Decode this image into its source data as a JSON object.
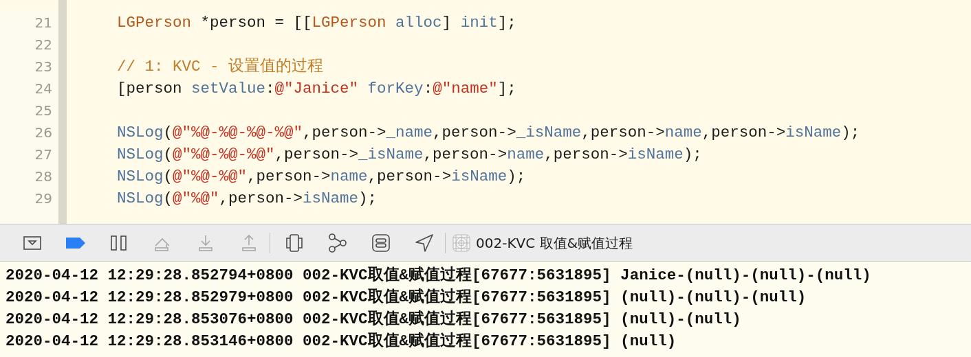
{
  "editor": {
    "lines": [
      {
        "number": "21",
        "tokens": [
          {
            "kind": "type",
            "text": "LGPerson"
          },
          {
            "kind": "plain",
            "text": " *person = [["
          },
          {
            "kind": "type",
            "text": "LGPerson"
          },
          {
            "kind": "method",
            "text": " alloc"
          },
          {
            "kind": "plain",
            "text": "] "
          },
          {
            "kind": "method",
            "text": "init"
          },
          {
            "kind": "plain",
            "text": "];"
          }
        ]
      },
      {
        "number": "22"
      },
      {
        "number": "23",
        "tokens": [
          {
            "kind": "comment",
            "text": "// 1: KVC - 设置值的过程"
          }
        ]
      },
      {
        "number": "24",
        "tokens": [
          {
            "kind": "plain",
            "text": "[person "
          },
          {
            "kind": "method",
            "text": "setValue"
          },
          {
            "kind": "plain",
            "text": ":"
          },
          {
            "kind": "string",
            "text": "@\"Janice\""
          },
          {
            "kind": "method",
            "text": " forKey"
          },
          {
            "kind": "plain",
            "text": ":"
          },
          {
            "kind": "string",
            "text": "@\"name\""
          },
          {
            "kind": "plain",
            "text": "];"
          }
        ]
      },
      {
        "number": "25"
      },
      {
        "number": "26",
        "tokens": [
          {
            "kind": "method",
            "text": "NSLog"
          },
          {
            "kind": "plain",
            "text": "("
          },
          {
            "kind": "string",
            "text": "@\"%@-%@-%@-%@\""
          },
          {
            "kind": "plain",
            "text": ",person->"
          },
          {
            "kind": "method",
            "text": "_name"
          },
          {
            "kind": "plain",
            "text": ",person->"
          },
          {
            "kind": "method",
            "text": "_isName"
          },
          {
            "kind": "plain",
            "text": ",person->"
          },
          {
            "kind": "method",
            "text": "name"
          },
          {
            "kind": "plain",
            "text": ",person->"
          },
          {
            "kind": "method",
            "text": "isName"
          },
          {
            "kind": "plain",
            "text": ");"
          }
        ]
      },
      {
        "number": "27",
        "tokens": [
          {
            "kind": "method",
            "text": "NSLog"
          },
          {
            "kind": "plain",
            "text": "("
          },
          {
            "kind": "string",
            "text": "@\"%@-%@-%@\""
          },
          {
            "kind": "plain",
            "text": ",person->"
          },
          {
            "kind": "method",
            "text": "_isName"
          },
          {
            "kind": "plain",
            "text": ",person->"
          },
          {
            "kind": "method",
            "text": "name"
          },
          {
            "kind": "plain",
            "text": ",person->"
          },
          {
            "kind": "method",
            "text": "isName"
          },
          {
            "kind": "plain",
            "text": ");"
          }
        ]
      },
      {
        "number": "28",
        "tokens": [
          {
            "kind": "method",
            "text": "NSLog"
          },
          {
            "kind": "plain",
            "text": "("
          },
          {
            "kind": "string",
            "text": "@\"%@-%@\""
          },
          {
            "kind": "plain",
            "text": ",person->"
          },
          {
            "kind": "method",
            "text": "name"
          },
          {
            "kind": "plain",
            "text": ",person->"
          },
          {
            "kind": "method",
            "text": "isName"
          },
          {
            "kind": "plain",
            "text": ");"
          }
        ]
      },
      {
        "number": "29",
        "tokens": [
          {
            "kind": "method",
            "text": "NSLog"
          },
          {
            "kind": "plain",
            "text": "("
          },
          {
            "kind": "string",
            "text": "@\"%@\""
          },
          {
            "kind": "plain",
            "text": ",person->"
          },
          {
            "kind": "method",
            "text": "isName"
          },
          {
            "kind": "plain",
            "text": ");"
          }
        ]
      }
    ]
  },
  "debug_bar": {
    "buttons": [
      {
        "kind": "hide-console",
        "disabled": false,
        "on": false
      },
      {
        "kind": "breakpoints",
        "disabled": false,
        "on": true
      },
      {
        "kind": "pause",
        "disabled": false,
        "on": false
      },
      {
        "kind": "step-over",
        "disabled": true,
        "on": false
      },
      {
        "kind": "step-into",
        "disabled": true,
        "on": false
      },
      {
        "kind": "step-out",
        "disabled": true,
        "on": false
      },
      {
        "kind": "view-debugger",
        "disabled": false,
        "on": false
      },
      {
        "kind": "memory-graph",
        "disabled": false,
        "on": false
      },
      {
        "kind": "environment",
        "disabled": false,
        "on": false
      },
      {
        "kind": "location",
        "disabled": false,
        "on": false
      }
    ],
    "target": "002-KVC 取值&赋值过程"
  },
  "console": {
    "lines": [
      "2020-04-12 12:29:28.852794+0800 002-KVC取值&赋值过程[67677:5631895] Janice-(null)-(null)-(null)",
      "2020-04-12 12:29:28.852979+0800 002-KVC取值&赋值过程[67677:5631895] (null)-(null)-(null)",
      "2020-04-12 12:29:28.853076+0800 002-KVC取值&赋值过程[67677:5631895] (null)-(null)",
      "2020-04-12 12:29:28.853146+0800 002-KVC取值&赋值过程[67677:5631895] (null)"
    ]
  }
}
